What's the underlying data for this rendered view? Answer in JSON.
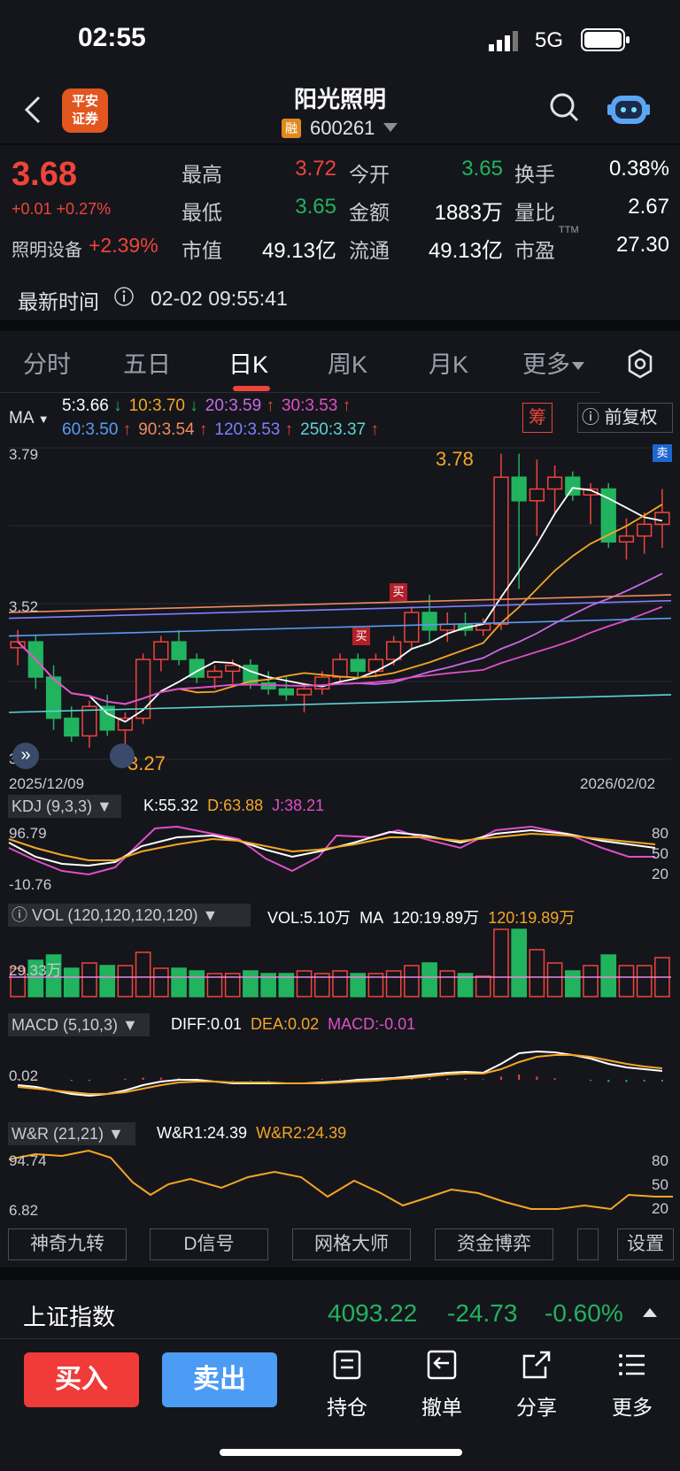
{
  "status": {
    "time": "02:55",
    "network": "5G"
  },
  "header": {
    "logo": [
      "平安",
      "证券"
    ],
    "name": "阳光照明",
    "badge": "融",
    "code": "600261"
  },
  "quote": {
    "price": "3.68",
    "change": "+0.01 +0.27%",
    "high_label": "最高",
    "high": "3.72",
    "open_label": "今开",
    "open": "3.65",
    "turnover_label": "换手",
    "turnover": "0.38%",
    "low_label": "最低",
    "low": "3.65",
    "amount_label": "金额",
    "amount": "1883万",
    "vol_ratio_label": "量比",
    "vol_ratio": "2.67",
    "sector": "照明设备",
    "sector_change": "+2.39%",
    "mcap_label": "市值",
    "mcap": "49.13亿",
    "float_label": "流通",
    "float": "49.13亿",
    "pe_label": "市盈",
    "pe_sup": "TTM",
    "pe": "27.30",
    "latest_label": "最新时间",
    "latest_time": "02-02 09:55:41"
  },
  "tabs": [
    "分时",
    "五日",
    "日K",
    "周K",
    "月K",
    "更多"
  ],
  "active_tab": "日K",
  "ma": {
    "label": "MA",
    "items": [
      {
        "text": "5:3.66",
        "arrow": "↓",
        "color": "#ffffff",
        "arrow_color": "#22b35e"
      },
      {
        "text": "10:3.70",
        "arrow": "↓",
        "color": "#f5a623",
        "arrow_color": "#22b35e"
      },
      {
        "text": "20:3.59",
        "arrow": "↑",
        "color": "#c86ae6",
        "arrow_color": "#f0443a"
      },
      {
        "text": "30:3.53",
        "arrow": "↑",
        "color": "#e14ec7",
        "arrow_color": "#f0443a"
      },
      {
        "text": "60:3.50",
        "arrow": "↑",
        "color": "#5b9cf0",
        "arrow_color": "#f0443a"
      },
      {
        "text": "90:3.54",
        "arrow": "↑",
        "color": "#f08a5d",
        "arrow_color": "#f0443a"
      },
      {
        "text": "120:3.53",
        "arrow": "↑",
        "color": "#7f7fff",
        "arrow_color": "#f0443a"
      },
      {
        "text": "250:3.37",
        "arrow": "↑",
        "color": "#5fd3d3",
        "arrow_color": "#f0443a"
      }
    ],
    "chou": "筹",
    "fq": "前复权"
  },
  "kline": {
    "y_top": "3.79",
    "y_mid": "3.52",
    "y_bot": "3.26",
    "hi_marker": "3.78",
    "lo_marker": "3.27",
    "date_start": "2025/12/09",
    "date_end": "2026/02/02",
    "buy_tag": "买",
    "sell_tag": "卖"
  },
  "chart_data": {
    "type": "candlestick",
    "ylim": [
      3.26,
      3.79
    ],
    "ohlc": [
      [
        3.45,
        3.48,
        3.42,
        3.46
      ],
      [
        3.46,
        3.47,
        3.38,
        3.4
      ],
      [
        3.4,
        3.42,
        3.31,
        3.33
      ],
      [
        3.33,
        3.35,
        3.29,
        3.3
      ],
      [
        3.3,
        3.36,
        3.28,
        3.35
      ],
      [
        3.35,
        3.37,
        3.3,
        3.31
      ],
      [
        3.31,
        3.34,
        3.27,
        3.33
      ],
      [
        3.33,
        3.44,
        3.32,
        3.43
      ],
      [
        3.43,
        3.47,
        3.41,
        3.46
      ],
      [
        3.46,
        3.48,
        3.42,
        3.43
      ],
      [
        3.43,
        3.44,
        3.39,
        3.4
      ],
      [
        3.4,
        3.42,
        3.38,
        3.41
      ],
      [
        3.41,
        3.43,
        3.39,
        3.42
      ],
      [
        3.42,
        3.43,
        3.38,
        3.39
      ],
      [
        3.39,
        3.41,
        3.37,
        3.38
      ],
      [
        3.38,
        3.4,
        3.36,
        3.37
      ],
      [
        3.37,
        3.39,
        3.34,
        3.38
      ],
      [
        3.38,
        3.41,
        3.37,
        3.4
      ],
      [
        3.4,
        3.44,
        3.39,
        3.43
      ],
      [
        3.43,
        3.44,
        3.4,
        3.41
      ],
      [
        3.41,
        3.44,
        3.4,
        3.43
      ],
      [
        3.43,
        3.47,
        3.42,
        3.46
      ],
      [
        3.46,
        3.52,
        3.45,
        3.51
      ],
      [
        3.51,
        3.54,
        3.46,
        3.48
      ],
      [
        3.48,
        3.51,
        3.46,
        3.49
      ],
      [
        3.49,
        3.51,
        3.47,
        3.48
      ],
      [
        3.48,
        3.5,
        3.47,
        3.49
      ],
      [
        3.49,
        3.78,
        3.48,
        3.74
      ],
      [
        3.74,
        3.78,
        3.55,
        3.7
      ],
      [
        3.7,
        3.77,
        3.64,
        3.72
      ],
      [
        3.72,
        3.76,
        3.68,
        3.74
      ],
      [
        3.74,
        3.75,
        3.7,
        3.71
      ],
      [
        3.71,
        3.73,
        3.66,
        3.72
      ],
      [
        3.72,
        3.73,
        3.62,
        3.63
      ],
      [
        3.63,
        3.67,
        3.6,
        3.64
      ],
      [
        3.64,
        3.68,
        3.61,
        3.66
      ],
      [
        3.66,
        3.72,
        3.62,
        3.68
      ]
    ]
  },
  "kdj": {
    "title": "KDJ (9,3,3)",
    "k": "K:55.32",
    "d": "D:63.88",
    "j": "J:38.21",
    "y_top": "96.79",
    "y_bot": "-10.76",
    "r80": "80",
    "r50": "50",
    "r20": "20"
  },
  "vol": {
    "title": "VOL (120,120,120,120)",
    "vol": "VOL:5.10万",
    "ma_label": "MA",
    "ma1": "120:19.89万",
    "ma2": "120:19.89万",
    "y_lbl": "29.33万"
  },
  "macd": {
    "title": "MACD (5,10,3)",
    "diff": "DIFF:0.01",
    "dea": "DEA:0.02",
    "macd": "MACD:-0.01",
    "y_lbl": "0.02"
  },
  "wr": {
    "title": "W&R (21,21)",
    "wr1": "W&R1:24.39",
    "wr2": "W&R2:24.39",
    "y_top": "94.74",
    "y_bot": "6.82",
    "r80": "80",
    "r50": "50",
    "r20": "20"
  },
  "tools": [
    "神奇九转",
    "D信号",
    "网格大师",
    "资金博弈",
    "设置"
  ],
  "index": {
    "name": "上证指数",
    "value": "4093.22",
    "change": "-24.73",
    "pct": "-0.60%"
  },
  "bottom": {
    "buy": "买入",
    "sell": "卖出",
    "hold": "持仓",
    "cancel": "撤单",
    "share": "分享",
    "more": "更多"
  }
}
